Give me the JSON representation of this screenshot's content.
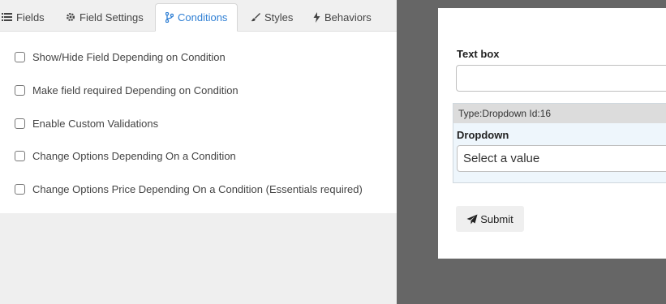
{
  "tabs": [
    {
      "label": "Fields",
      "icon": "list-icon"
    },
    {
      "label": "Field Settings",
      "icon": "gear-icon"
    },
    {
      "label": "Conditions",
      "icon": "branch-icon",
      "active": true
    },
    {
      "label": "Styles",
      "icon": "brush-icon"
    },
    {
      "label": "Behaviors",
      "icon": "bolt-icon"
    }
  ],
  "conditions": {
    "options": [
      {
        "label": "Show/Hide Field Depending on Condition",
        "checked": false
      },
      {
        "label": "Make field required Depending on Condition",
        "checked": false
      },
      {
        "label": "Enable Custom Validations",
        "checked": false
      },
      {
        "label": "Change Options Depending On a Condition",
        "checked": false
      },
      {
        "label": "Change Options Price Depending On a Condition (Essentials required)",
        "checked": false
      }
    ]
  },
  "preview": {
    "textbox_label": "Text box",
    "textbox_value": "",
    "field_type_info": "Type:Dropdown Id:16",
    "dropdown_label": "Dropdown",
    "dropdown_value": "Select a value",
    "submit_label": "Submit",
    "submit_icon": "paper-plane-icon"
  },
  "colors": {
    "active_tab": "#2f7fd4",
    "preview_background": "#666666",
    "selected_field_background": "#eef6fc"
  }
}
